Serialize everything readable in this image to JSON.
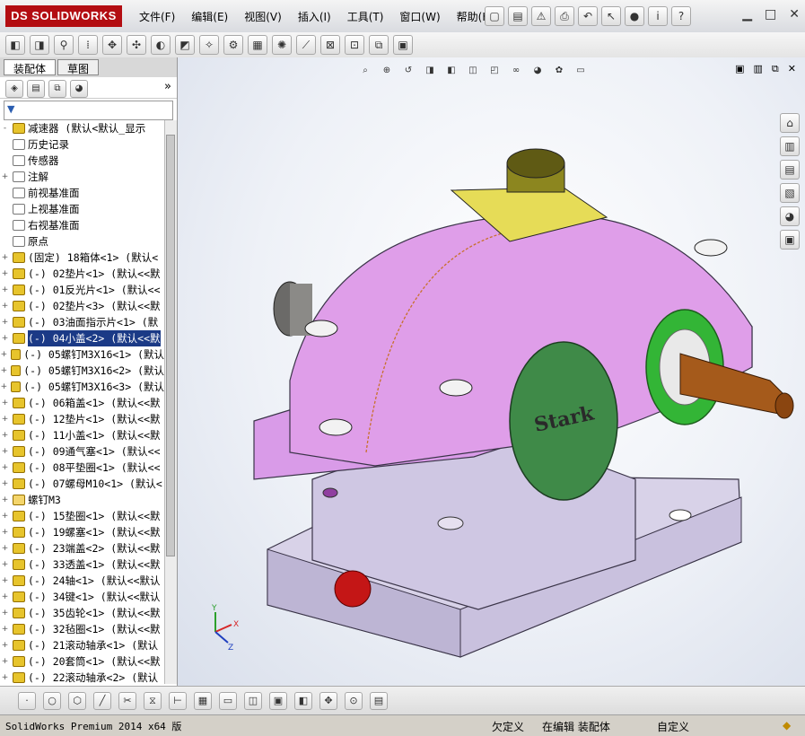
{
  "app": {
    "logo": "DS SOLIDWORKS"
  },
  "menu": [
    "文件(F)",
    "编辑(E)",
    "视图(V)",
    "插入(I)",
    "工具(T)",
    "窗口(W)",
    "帮助(H)"
  ],
  "panel": {
    "tabs": [
      "装配体",
      "草图"
    ],
    "tree": [
      {
        "label": "减速器  (默认<默认_显示",
        "type": "assembly",
        "exp": "-"
      },
      {
        "label": "历史记录",
        "type": "plain",
        "exp": ""
      },
      {
        "label": "传感器",
        "type": "plain",
        "exp": ""
      },
      {
        "label": "注解",
        "type": "plain",
        "exp": "+"
      },
      {
        "label": "前视基准面",
        "type": "plain",
        "exp": ""
      },
      {
        "label": "上视基准面",
        "type": "plain",
        "exp": ""
      },
      {
        "label": "右视基准面",
        "type": "plain",
        "exp": ""
      },
      {
        "label": "原点",
        "type": "plain",
        "exp": ""
      },
      {
        "label": "(固定) 18箱体<1> (默认<",
        "type": "part",
        "exp": "+"
      },
      {
        "label": "(-) 02垫片<1> (默认<<默",
        "type": "part",
        "exp": "+"
      },
      {
        "label": "(-) 01反光片<1> (默认<<",
        "type": "part",
        "exp": "+"
      },
      {
        "label": "(-) 02垫片<3> (默认<<默",
        "type": "part",
        "exp": "+"
      },
      {
        "label": "(-) 03油面指示片<1> (默",
        "type": "part",
        "exp": "+"
      },
      {
        "label": "(-) 04小盖<2> (默认<<默",
        "type": "part",
        "exp": "+",
        "selected": true
      },
      {
        "label": "(-) 05螺钉M3X16<1> (默认",
        "type": "part",
        "exp": "+"
      },
      {
        "label": "(-) 05螺钉M3X16<2> (默认",
        "type": "part",
        "exp": "+"
      },
      {
        "label": "(-) 05螺钉M3X16<3> (默认",
        "type": "part",
        "exp": "+"
      },
      {
        "label": "(-) 06箱盖<1> (默认<<默",
        "type": "part",
        "exp": "+"
      },
      {
        "label": "(-) 12垫片<1> (默认<<默",
        "type": "part",
        "exp": "+"
      },
      {
        "label": "(-) 11小盖<1> (默认<<默",
        "type": "part",
        "exp": "+"
      },
      {
        "label": "(-) 09通气塞<1> (默认<<",
        "type": "part",
        "exp": "+"
      },
      {
        "label": "(-) 08平垫圈<1> (默认<<",
        "type": "part",
        "exp": "+"
      },
      {
        "label": "(-) 07螺母M10<1> (默认<",
        "type": "part",
        "exp": "+"
      },
      {
        "label": "螺钉M3",
        "type": "folder",
        "exp": "+"
      },
      {
        "label": "(-) 15垫圈<1> (默认<<默",
        "type": "part",
        "exp": "+"
      },
      {
        "label": "(-) 19螺塞<1> (默认<<默",
        "type": "part",
        "exp": "+"
      },
      {
        "label": "(-) 23端盖<2> (默认<<默",
        "type": "part",
        "exp": "+"
      },
      {
        "label": "(-) 33透盖<1> (默认<<默",
        "type": "part",
        "exp": "+"
      },
      {
        "label": "(-) 24轴<1> (默认<<默认",
        "type": "part",
        "exp": "+"
      },
      {
        "label": "(-) 34键<1> (默认<<默认",
        "type": "part",
        "exp": "+"
      },
      {
        "label": "(-) 35齿轮<1> (默认<<默",
        "type": "part",
        "exp": "+"
      },
      {
        "label": "(-) 32毡圈<1> (默认<<默",
        "type": "part",
        "exp": "+"
      },
      {
        "label": "(-) 21滚动轴承<1> (默认",
        "type": "part",
        "exp": "+"
      },
      {
        "label": "(-) 20套筒<1> (默认<<默",
        "type": "part",
        "exp": "+"
      },
      {
        "label": "(-) 22滚动轴承<2> (默认",
        "type": "part",
        "exp": "+"
      }
    ]
  },
  "model": {
    "emblem": "Stark"
  },
  "axis": {
    "x": "X",
    "y": "Y",
    "z": "Z"
  },
  "status": {
    "product": "SolidWorks Premium 2014 x64 版",
    "s1": "欠定义",
    "s2": "在编辑 装配体",
    "s3": "自定义"
  }
}
